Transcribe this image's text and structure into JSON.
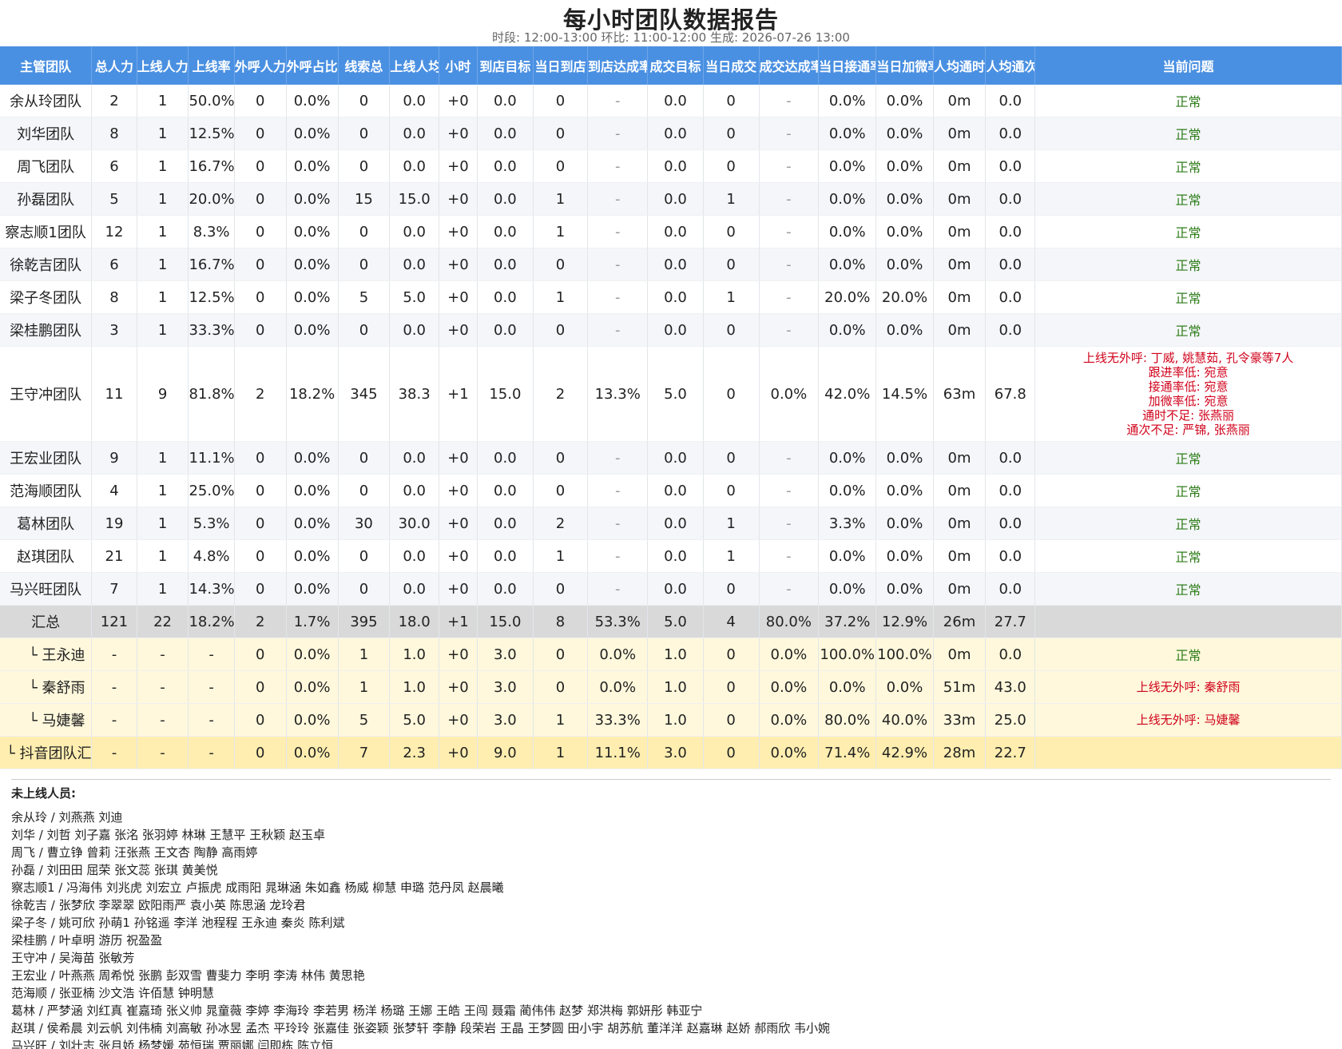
{
  "title": "每小时团队数据报告",
  "subtitle": "时段: 12:00-13:00  环比: 11:00-12:00  生成: 2026-07-26 13:00",
  "columns": [
    "主管团队",
    "总人力",
    "上线人力",
    "上线率",
    "外呼人力",
    "外呼占比",
    "线索总",
    "上线人均",
    "小时",
    "到店目标",
    "当日到店",
    "到店达成率",
    "成交目标",
    "当日成交",
    "成交达成率",
    "当日接通率",
    "当日加微率",
    "人均通时",
    "人均通次",
    "当前问题"
  ],
  "rows": [
    {
      "cells": [
        "余从玲团队",
        "2",
        "1",
        "50.0%",
        "0",
        "0.0%",
        "0",
        "0.0",
        "+0",
        "0.0",
        "0",
        "-",
        "0.0",
        "0",
        "-",
        "0.0%",
        "0.0%",
        "0m",
        "0.0"
      ],
      "issues": [
        "正常"
      ],
      "ok": true
    },
    {
      "cells": [
        "刘华团队",
        "8",
        "1",
        "12.5%",
        "0",
        "0.0%",
        "0",
        "0.0",
        "+0",
        "0.0",
        "0",
        "-",
        "0.0",
        "0",
        "-",
        "0.0%",
        "0.0%",
        "0m",
        "0.0"
      ],
      "issues": [
        "正常"
      ],
      "ok": true
    },
    {
      "cells": [
        "周飞团队",
        "6",
        "1",
        "16.7%",
        "0",
        "0.0%",
        "0",
        "0.0",
        "+0",
        "0.0",
        "0",
        "-",
        "0.0",
        "0",
        "-",
        "0.0%",
        "0.0%",
        "0m",
        "0.0"
      ],
      "issues": [
        "正常"
      ],
      "ok": true
    },
    {
      "cells": [
        "孙磊团队",
        "5",
        "1",
        "20.0%",
        "0",
        "0.0%",
        "15",
        "15.0",
        "+0",
        "0.0",
        "1",
        "-",
        "0.0",
        "1",
        "-",
        "0.0%",
        "0.0%",
        "0m",
        "0.0"
      ],
      "issues": [
        "正常"
      ],
      "ok": true
    },
    {
      "cells": [
        "察志顺1团队",
        "12",
        "1",
        "8.3%",
        "0",
        "0.0%",
        "0",
        "0.0",
        "+0",
        "0.0",
        "1",
        "-",
        "0.0",
        "0",
        "-",
        "0.0%",
        "0.0%",
        "0m",
        "0.0"
      ],
      "issues": [
        "正常"
      ],
      "ok": true
    },
    {
      "cells": [
        "徐乾吉团队",
        "6",
        "1",
        "16.7%",
        "0",
        "0.0%",
        "0",
        "0.0",
        "+0",
        "0.0",
        "0",
        "-",
        "0.0",
        "0",
        "-",
        "0.0%",
        "0.0%",
        "0m",
        "0.0"
      ],
      "issues": [
        "正常"
      ],
      "ok": true
    },
    {
      "cells": [
        "梁子冬团队",
        "8",
        "1",
        "12.5%",
        "0",
        "0.0%",
        "5",
        "5.0",
        "+0",
        "0.0",
        "1",
        "-",
        "0.0",
        "1",
        "-",
        "20.0%",
        "20.0%",
        "0m",
        "0.0"
      ],
      "issues": [
        "正常"
      ],
      "ok": true
    },
    {
      "cells": [
        "梁桂鹏团队",
        "3",
        "1",
        "33.3%",
        "0",
        "0.0%",
        "0",
        "0.0",
        "+0",
        "0.0",
        "0",
        "-",
        "0.0",
        "0",
        "-",
        "0.0%",
        "0.0%",
        "0m",
        "0.0"
      ],
      "issues": [
        "正常"
      ],
      "ok": true
    },
    {
      "cells": [
        "王守冲团队",
        "11",
        "9",
        "81.8%",
        "2",
        "18.2%",
        "345",
        "38.3",
        "+1",
        "15.0",
        "2",
        "13.3%",
        "5.0",
        "0",
        "0.0%",
        "42.0%",
        "14.5%",
        "63m",
        "67.8"
      ],
      "issues": [
        "上线无外呼: 丁威, 姚慧茹, 孔令豪等7人",
        "跟进率低: 宛意",
        "接通率低: 宛意",
        "加微率低: 宛意",
        "通时不足: 张燕丽",
        "通次不足: 严锦, 张燕丽"
      ],
      "ok": false
    },
    {
      "cells": [
        "王宏业团队",
        "9",
        "1",
        "11.1%",
        "0",
        "0.0%",
        "0",
        "0.0",
        "+0",
        "0.0",
        "0",
        "-",
        "0.0",
        "0",
        "-",
        "0.0%",
        "0.0%",
        "0m",
        "0.0"
      ],
      "issues": [
        "正常"
      ],
      "ok": true
    },
    {
      "cells": [
        "范海顺团队",
        "4",
        "1",
        "25.0%",
        "0",
        "0.0%",
        "0",
        "0.0",
        "+0",
        "0.0",
        "0",
        "-",
        "0.0",
        "0",
        "-",
        "0.0%",
        "0.0%",
        "0m",
        "0.0"
      ],
      "issues": [
        "正常"
      ],
      "ok": true
    },
    {
      "cells": [
        "葛林团队",
        "19",
        "1",
        "5.3%",
        "0",
        "0.0%",
        "30",
        "30.0",
        "+0",
        "0.0",
        "2",
        "-",
        "0.0",
        "1",
        "-",
        "3.3%",
        "0.0%",
        "0m",
        "0.0"
      ],
      "issues": [
        "正常"
      ],
      "ok": true
    },
    {
      "cells": [
        "赵琪团队",
        "21",
        "1",
        "4.8%",
        "0",
        "0.0%",
        "0",
        "0.0",
        "+0",
        "0.0",
        "1",
        "-",
        "0.0",
        "1",
        "-",
        "0.0%",
        "0.0%",
        "0m",
        "0.0"
      ],
      "issues": [
        "正常"
      ],
      "ok": true
    },
    {
      "cells": [
        "马兴旺团队",
        "7",
        "1",
        "14.3%",
        "0",
        "0.0%",
        "0",
        "0.0",
        "+0",
        "0.0",
        "0",
        "-",
        "0.0",
        "0",
        "-",
        "0.0%",
        "0.0%",
        "0m",
        "0.0"
      ],
      "issues": [
        "正常"
      ],
      "ok": true
    }
  ],
  "total": {
    "cells": [
      "汇总",
      "121",
      "22",
      "18.2%",
      "2",
      "1.7%",
      "395",
      "18.0",
      "+1",
      "15.0",
      "8",
      "53.3%",
      "5.0",
      "4",
      "80.0%",
      "37.2%",
      "12.9%",
      "26m",
      "27.7"
    ],
    "issues": []
  },
  "sub_rows": [
    {
      "cells": [
        "└ 王永迪",
        "-",
        "-",
        "-",
        "0",
        "0.0%",
        "1",
        "1.0",
        "+0",
        "3.0",
        "0",
        "0.0%",
        "1.0",
        "0",
        "0.0%",
        "100.0%",
        "100.0%",
        "0m",
        "0.0"
      ],
      "issues": [
        "正常"
      ],
      "ok": true
    },
    {
      "cells": [
        "└ 秦舒雨",
        "-",
        "-",
        "-",
        "0",
        "0.0%",
        "1",
        "1.0",
        "+0",
        "3.0",
        "0",
        "0.0%",
        "1.0",
        "0",
        "0.0%",
        "0.0%",
        "0.0%",
        "51m",
        "43.0"
      ],
      "issues": [
        "上线无外呼: 秦舒雨"
      ],
      "ok": false
    },
    {
      "cells": [
        "└ 马婕馨",
        "-",
        "-",
        "-",
        "0",
        "0.0%",
        "5",
        "5.0",
        "+0",
        "3.0",
        "1",
        "33.3%",
        "1.0",
        "0",
        "0.0%",
        "80.0%",
        "40.0%",
        "33m",
        "25.0"
      ],
      "issues": [
        "上线无外呼: 马婕馨"
      ],
      "ok": false
    }
  ],
  "subtotal": {
    "cells": [
      "└ 抖音团队汇总",
      "-",
      "-",
      "-",
      "0",
      "0.0%",
      "7",
      "2.3",
      "+0",
      "9.0",
      "1",
      "11.1%",
      "3.0",
      "0",
      "0.0%",
      "71.4%",
      "42.9%",
      "28m",
      "22.7"
    ],
    "issues": []
  },
  "offline": {
    "title": "未上线人员:",
    "lines": [
      "余从玲 / 刘燕燕 刘迪",
      "刘华 / 刘哲 刘子嘉 张洺 张羽婷 林琳 王慧平 王秋颖 赵玉卓",
      "周飞 / 曹立铮 曾莉 汪张燕 王文杏 陶静 高雨婷",
      "孙磊 / 刘田田 屈荣 张文蕊 张琪 黄美悦",
      "察志顺1 / 冯海伟 刘兆虎 刘宏立 卢振虎 成雨阳 晁琳涵 朱如鑫 杨威 柳慧 申璐 范丹凤 赵晨曦",
      "徐乾吉 / 张梦欣 李翠翠 欧阳雨严 袁小英 陈思涵 龙玲君",
      "梁子冬 / 姚可欣 孙萌1 孙铭遥 李洋 池程程 王永迪 秦炎 陈利斌",
      "梁桂鹏 / 叶卓明 游历 祝盈盈",
      "王守冲 / 吴海苗 张敏芳",
      "王宏业 / 叶燕燕 周希悦 张鹏 彭双雪 曹斐力 李明 李涛 林伟 黄思艳",
      "范海顺 / 张亚楠 沙文浩 许佰慧 钟明慧",
      "葛林 / 严梦涵 刘红真 崔嘉琦 张义帅 晁童薇 李婷 李海玲 李若男 杨洋 杨璐 王娜 王皓 王闯 聂霜 蔺伟伟 赵梦 郑洪梅 郭妍彤 韩亚宁",
      "赵琪 / 侯希晨 刘云帆 刘伟楠 刘高敏 孙冰昱 孟杰 平玲玲 张嘉佳 张姿颖 张梦轩 李静 段荣岩 王晶 王梦圆 田小宇 胡苏航 董洋洋 赵嘉琳 赵娇 郝雨欣 韦小婉",
      "马兴旺 / 刘壮志 张月娇 杨梦媛 苑恒瑞 贾丽娜 闫即栋 陈立恒"
    ]
  }
}
